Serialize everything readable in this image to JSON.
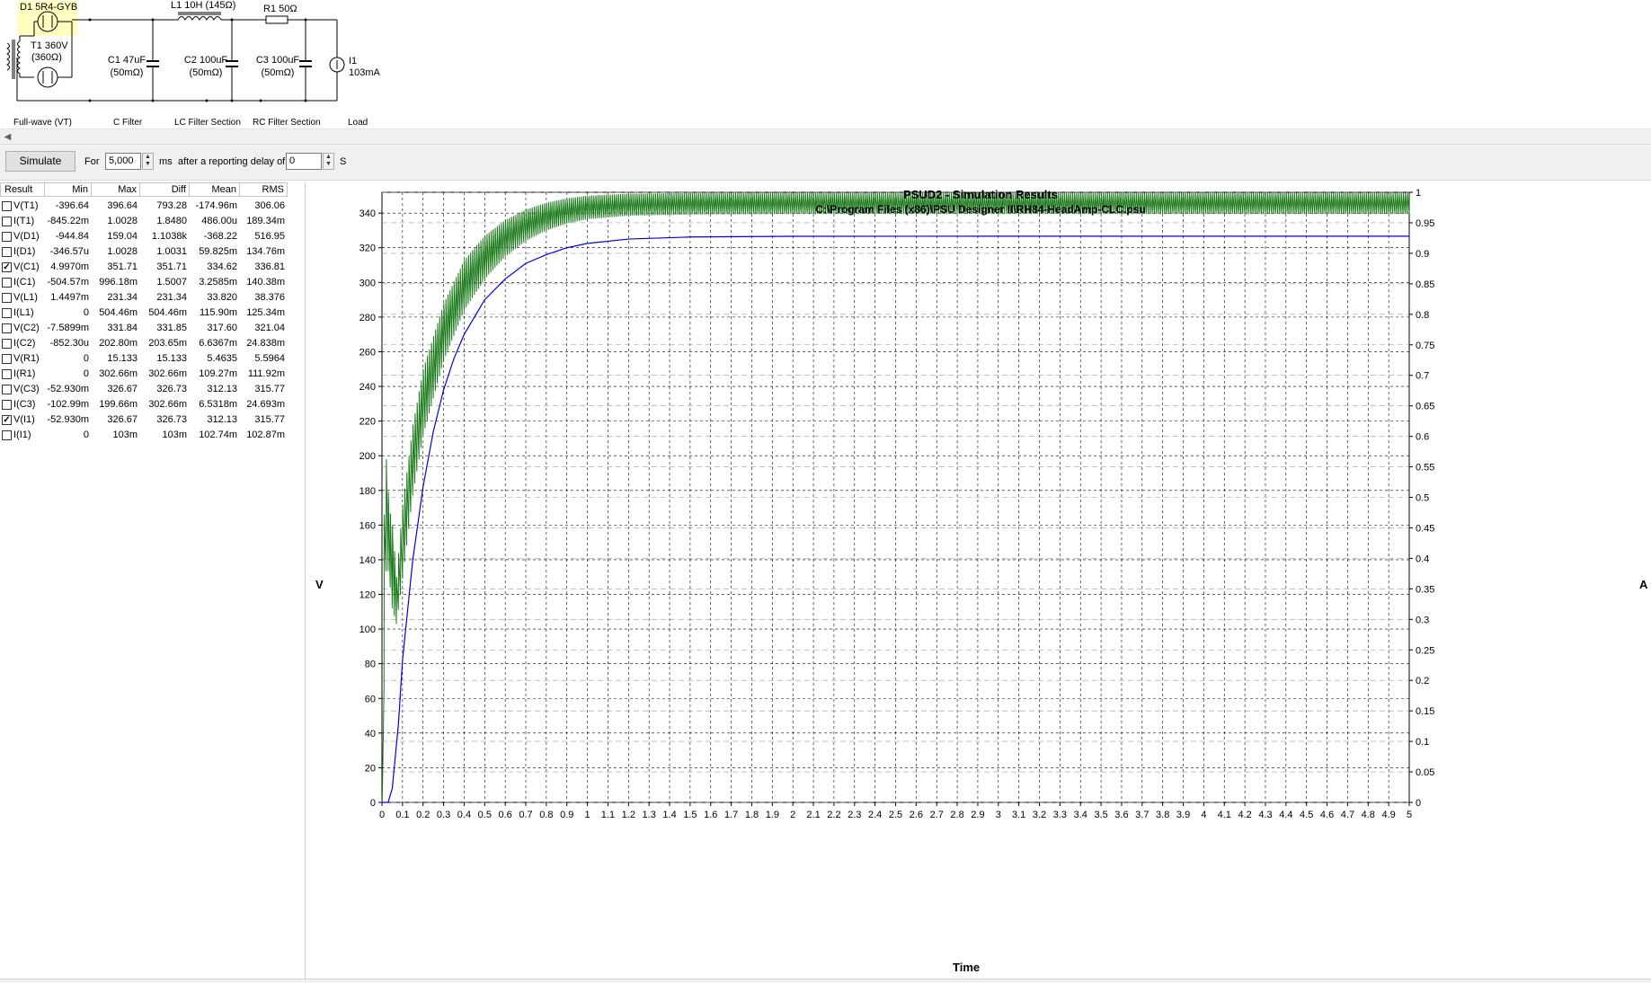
{
  "schematic": {
    "components": {
      "d1": "D1 5R4-GYB",
      "l1": "L1 10H (145Ω)",
      "r1": "R1 50Ω",
      "t1_line1": "T1 360V",
      "t1_line2": "(360Ω)",
      "c1_line1": "C1 47uF",
      "c1_line2": "(50mΩ)",
      "c2_line1": "C2 100uF",
      "c2_line2": "(50mΩ)",
      "c3_line1": "C3 100uF",
      "c3_line2": "(50mΩ)",
      "i1_line1": "I1",
      "i1_line2": "103mA"
    },
    "sections": [
      "Full-wave (VT)",
      "C Filter",
      "LC Filter Section",
      "RC Filter Section",
      "Load"
    ],
    "highlight_color": "#ffffc0"
  },
  "toolbar": {
    "simulate_label": "Simulate",
    "for_label": "For",
    "duration_value": "5,000",
    "ms_label": "ms",
    "delay_label": "after a reporting delay of",
    "delay_value": "0",
    "s_label": "S"
  },
  "results": {
    "headers": [
      "Result",
      "Min",
      "Max",
      "Diff",
      "Mean",
      "RMS"
    ],
    "rows": [
      {
        "name": "V(T1)",
        "min": "-396.64",
        "max": "396.64",
        "diff": "793.28",
        "mean": "-174.96m",
        "rms": "306.06",
        "checked": false
      },
      {
        "name": "I(T1)",
        "min": "-845.22m",
        "max": "1.0028",
        "diff": "1.8480",
        "mean": "486.00u",
        "rms": "189.34m",
        "checked": false
      },
      {
        "name": "V(D1)",
        "min": "-944.84",
        "max": "159.04",
        "diff": "1.1038k",
        "mean": "-368.22",
        "rms": "516.95",
        "checked": false
      },
      {
        "name": "I(D1)",
        "min": "-346.57u",
        "max": "1.0028",
        "diff": "1.0031",
        "mean": "59.825m",
        "rms": "134.76m",
        "checked": false
      },
      {
        "name": "V(C1)",
        "min": "4.9970m",
        "max": "351.71",
        "diff": "351.71",
        "mean": "334.62",
        "rms": "336.81",
        "checked": true
      },
      {
        "name": "I(C1)",
        "min": "-504.57m",
        "max": "996.18m",
        "diff": "1.5007",
        "mean": "3.2585m",
        "rms": "140.38m",
        "checked": false
      },
      {
        "name": "V(L1)",
        "min": "1.4497m",
        "max": "231.34",
        "diff": "231.34",
        "mean": "33.820",
        "rms": "38.376",
        "checked": false
      },
      {
        "name": "I(L1)",
        "min": "0",
        "max": "504.46m",
        "diff": "504.46m",
        "mean": "115.90m",
        "rms": "125.34m",
        "checked": false
      },
      {
        "name": "V(C2)",
        "min": "-7.5899m",
        "max": "331.84",
        "diff": "331.85",
        "mean": "317.60",
        "rms": "321.04",
        "checked": false
      },
      {
        "name": "I(C2)",
        "min": "-852.30u",
        "max": "202.80m",
        "diff": "203.65m",
        "mean": "6.6367m",
        "rms": "24.838m",
        "checked": false
      },
      {
        "name": "V(R1)",
        "min": "0",
        "max": "15.133",
        "diff": "15.133",
        "mean": "5.4635",
        "rms": "5.5964",
        "checked": false
      },
      {
        "name": "I(R1)",
        "min": "0",
        "max": "302.66m",
        "diff": "302.66m",
        "mean": "109.27m",
        "rms": "111.92m",
        "checked": false
      },
      {
        "name": "V(C3)",
        "min": "-52.930m",
        "max": "326.67",
        "diff": "326.73",
        "mean": "312.13",
        "rms": "315.77",
        "checked": false
      },
      {
        "name": "I(C3)",
        "min": "-102.99m",
        "max": "199.66m",
        "diff": "302.66m",
        "mean": "6.5318m",
        "rms": "24.693m",
        "checked": false
      },
      {
        "name": "V(I1)",
        "min": "-52.930m",
        "max": "326.67",
        "diff": "326.73",
        "mean": "312.13",
        "rms": "315.77",
        "checked": true
      },
      {
        "name": "I(I1)",
        "min": "0",
        "max": "103m",
        "diff": "103m",
        "mean": "102.74m",
        "rms": "102.87m",
        "checked": false
      }
    ]
  },
  "chart_data": {
    "type": "line",
    "title": "PSUD2 - Simulation Results",
    "subtitle": "C:\\Program Files (x86)\\PSU Designer II\\RH84-HeadAmp-CLC.psu",
    "xlabel": "Time",
    "ylabel": "V",
    "y2label": "A",
    "xlim": [
      0,
      5
    ],
    "ylim": [
      0,
      352
    ],
    "y2lim": [
      0,
      1
    ],
    "xticks": [
      "0",
      "0.1",
      "0.2",
      "0.3",
      "0.4",
      "0.5",
      "0.6",
      "0.7",
      "0.8",
      "0.9",
      "1",
      "1.1",
      "1.2",
      "1.3",
      "1.4",
      "1.5",
      "1.6",
      "1.7",
      "1.8",
      "1.9",
      "2",
      "2.1",
      "2.2",
      "2.3",
      "2.4",
      "2.5",
      "2.6",
      "2.7",
      "2.8",
      "2.9",
      "3",
      "3.1",
      "3.2",
      "3.3",
      "3.4",
      "3.5",
      "3.6",
      "3.7",
      "3.8",
      "3.9",
      "4",
      "4.1",
      "4.2",
      "4.3",
      "4.4",
      "4.5",
      "4.6",
      "4.7",
      "4.8",
      "4.9",
      "5"
    ],
    "yticks": [
      "0",
      "20",
      "40",
      "60",
      "80",
      "100",
      "120",
      "140",
      "160",
      "180",
      "200",
      "220",
      "240",
      "260",
      "280",
      "300",
      "320",
      "340"
    ],
    "y2ticks": [
      "0",
      "0.05",
      "0.1",
      "0.15",
      "0.2",
      "0.25",
      "0.3",
      "0.35",
      "0.4",
      "0.45",
      "0.5",
      "0.55",
      "0.6",
      "0.65",
      "0.7",
      "0.75",
      "0.8",
      "0.85",
      "0.9",
      "0.95",
      "1"
    ],
    "grid": true,
    "series": [
      {
        "name": "V(C1)",
        "color": "#1a7a1a",
        "ripple": true,
        "envelope_upper": [
          [
            0,
            0
          ],
          [
            0.005,
            150
          ],
          [
            0.02,
            198
          ],
          [
            0.035,
            170
          ],
          [
            0.05,
            160
          ],
          [
            0.07,
            130
          ],
          [
            0.1,
            172
          ],
          [
            0.15,
            218
          ],
          [
            0.2,
            250
          ],
          [
            0.3,
            288
          ],
          [
            0.4,
            313
          ],
          [
            0.5,
            327
          ],
          [
            0.6,
            336
          ],
          [
            0.7,
            342
          ],
          [
            0.8,
            346
          ],
          [
            0.9,
            348.5
          ],
          [
            1.0,
            350
          ],
          [
            1.2,
            351.2
          ],
          [
            1.5,
            351.6
          ],
          [
            2.0,
            351.7
          ],
          [
            5.0,
            351.7
          ]
        ],
        "envelope_lower": [
          [
            0,
            0
          ],
          [
            0.005,
            40
          ],
          [
            0.02,
            140
          ],
          [
            0.035,
            130
          ],
          [
            0.05,
            112
          ],
          [
            0.07,
            103
          ],
          [
            0.1,
            130
          ],
          [
            0.15,
            178
          ],
          [
            0.2,
            212
          ],
          [
            0.3,
            255
          ],
          [
            0.4,
            284
          ],
          [
            0.5,
            302
          ],
          [
            0.6,
            315
          ],
          [
            0.7,
            324
          ],
          [
            0.8,
            330
          ],
          [
            0.9,
            334
          ],
          [
            1.0,
            336.5
          ],
          [
            1.2,
            338.5
          ],
          [
            1.5,
            339.2
          ],
          [
            2.0,
            339.5
          ],
          [
            5.0,
            339.5
          ]
        ]
      },
      {
        "name": "V(I1)",
        "color": "#0000e0",
        "points": [
          [
            0,
            0
          ],
          [
            0.03,
            0
          ],
          [
            0.05,
            8
          ],
          [
            0.08,
            45
          ],
          [
            0.1,
            82
          ],
          [
            0.15,
            140
          ],
          [
            0.2,
            182
          ],
          [
            0.25,
            214
          ],
          [
            0.3,
            238
          ],
          [
            0.35,
            256
          ],
          [
            0.4,
            270
          ],
          [
            0.5,
            290
          ],
          [
            0.6,
            302
          ],
          [
            0.7,
            311
          ],
          [
            0.8,
            316
          ],
          [
            0.9,
            320
          ],
          [
            1.0,
            322.5
          ],
          [
            1.2,
            325
          ],
          [
            1.5,
            326.2
          ],
          [
            2.0,
            326.6
          ],
          [
            3.0,
            326.67
          ],
          [
            5.0,
            326.67
          ]
        ]
      }
    ]
  }
}
